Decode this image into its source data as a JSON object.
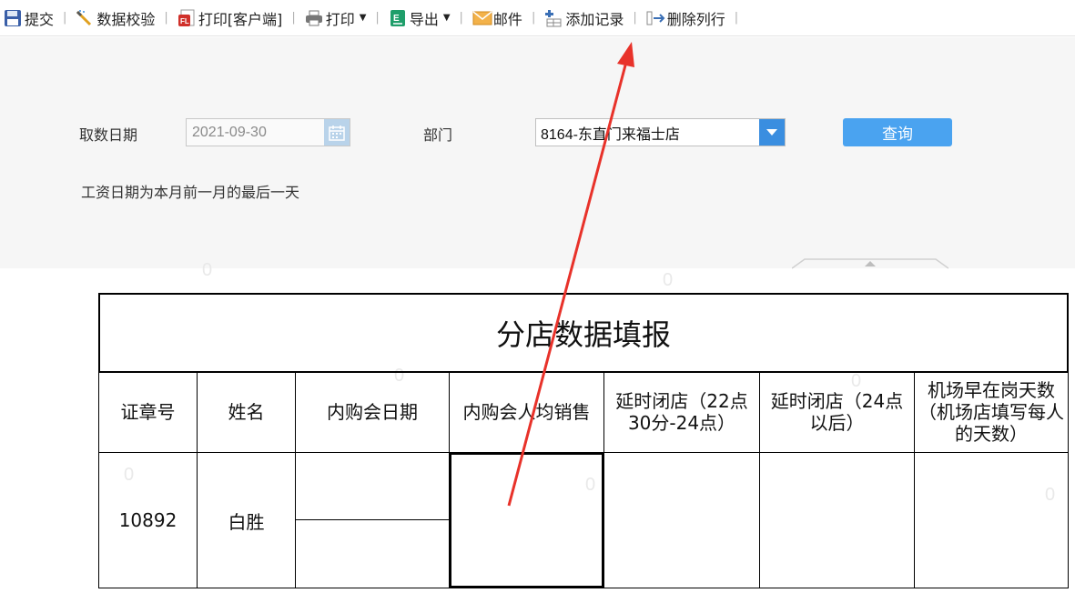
{
  "toolbar": {
    "items": [
      {
        "label": "提交",
        "icon": "save-icon",
        "dropdown": false
      },
      {
        "label": "数据校验",
        "icon": "validate-icon",
        "dropdown": false
      },
      {
        "label": "打印[客户端]",
        "icon": "print-client-icon",
        "dropdown": false
      },
      {
        "label": "打印",
        "icon": "printer-icon",
        "dropdown": true
      },
      {
        "label": "导出",
        "icon": "export-icon",
        "dropdown": true
      },
      {
        "label": "邮件",
        "icon": "mail-icon",
        "dropdown": false
      },
      {
        "label": "添加记录",
        "icon": "add-record-icon",
        "dropdown": false
      },
      {
        "label": "删除列行",
        "icon": "delete-row-icon",
        "dropdown": false
      }
    ]
  },
  "filter": {
    "date_label": "取数日期",
    "date_value": "2021-09-30",
    "dept_label": "部门",
    "dept_value": "8164-东直门来福士店",
    "query_label": "查询",
    "note": "工资日期为本月前一月的最后一天"
  },
  "report": {
    "title": "分店数据填报",
    "headers": [
      "证章号",
      "姓名",
      "内购会日期",
      "内购会人均销售",
      "延时闭店（22点30分-24点）",
      "延时闭店（24点以后）",
      "机场早在岗天数（机场店填写每人的天数）"
    ],
    "rows": [
      {
        "badge": "10892",
        "name": "白胜"
      }
    ]
  },
  "colors": {
    "accent": "#4aa3f0",
    "dropdown": "#3a8ee0",
    "filter_bg": "#f6f6f6",
    "annotation_arrow": "#e8322a"
  }
}
